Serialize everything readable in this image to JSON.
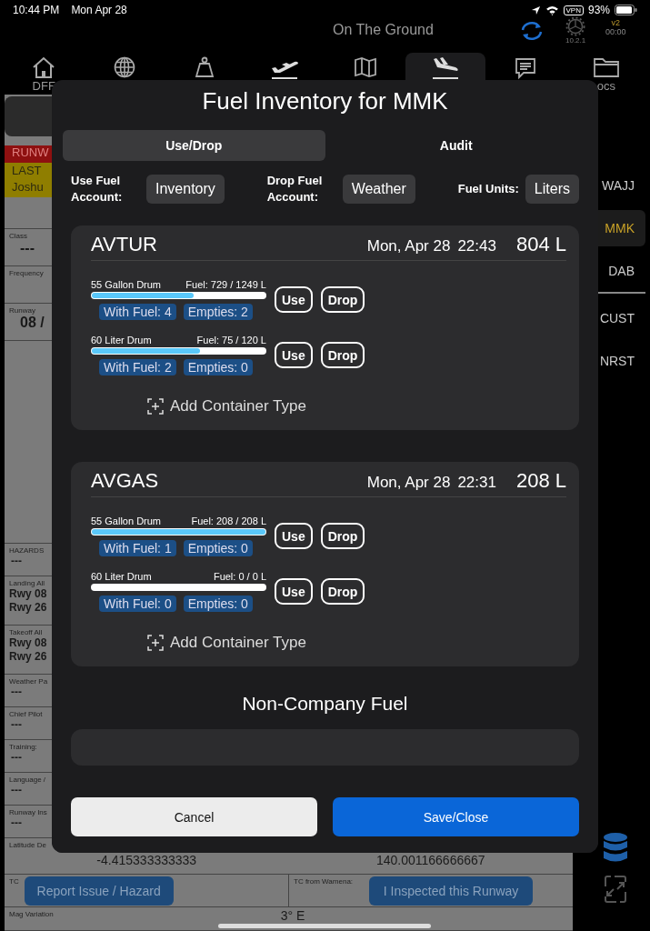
{
  "status_bar": {
    "time": "10:44 PM",
    "date": "Mon Apr 28",
    "vpn": "VPN",
    "battery": "93%"
  },
  "header": {
    "title": "On The Ground",
    "version": "10.2.1",
    "badge": "v2",
    "timer": "00:00"
  },
  "tabs": [
    {
      "kind": "home",
      "label": "DFF",
      "selected": false
    },
    {
      "kind": "globe",
      "selected": false
    },
    {
      "kind": "weight",
      "selected": false
    },
    {
      "kind": "takeoff",
      "selected": false
    },
    {
      "kind": "map",
      "selected": false
    },
    {
      "kind": "landing",
      "selected": true
    },
    {
      "kind": "chat",
      "selected": false
    },
    {
      "kind": "folder",
      "label": "ocs",
      "selected": false
    }
  ],
  "runway_panel": {
    "banner": "RUNW",
    "notice": [
      "LAST",
      "Joshu"
    ],
    "upper_fields": [
      {
        "label": "Class",
        "values": [
          "---"
        ]
      },
      {
        "label": "Frequency"
      },
      {
        "label": "Runway",
        "values": [
          "08 /"
        ]
      }
    ],
    "lower_fields": [
      {
        "label": "HAZARDS",
        "values": [
          "---"
        ]
      },
      {
        "label": "Landing All",
        "values": [
          "Rwy 08",
          "Rwy 26"
        ]
      },
      {
        "label": "Takeoff All",
        "values": [
          "Rwy 08",
          "Rwy 26"
        ]
      },
      {
        "label": "Weather Pa",
        "values": [
          "---"
        ]
      },
      {
        "label": "Chief Pilot",
        "values": [
          "---"
        ]
      },
      {
        "label": "Training:",
        "values": [
          "---"
        ]
      },
      {
        "label": "Language /",
        "values": [
          "---"
        ]
      },
      {
        "label": "Runway Ins",
        "values": [
          "---"
        ]
      }
    ],
    "coordinates": {
      "label": "Latitude De",
      "latitude": "-4.415333333333",
      "longitude": "140.001166666667"
    },
    "tc_row": {
      "left_label": "TC",
      "right_label": "TC from Wamena:"
    },
    "mag_variation": {
      "label": "Mag Variation",
      "value": "3° E"
    },
    "actions": [
      "Report Issue / Hazard",
      "I Inspected this Runway"
    ]
  },
  "sidebar": {
    "airports": [
      {
        "code": "WAJJ",
        "selected": false
      },
      {
        "code": "MMK",
        "selected": true
      },
      {
        "code": "DAB",
        "selected": false
      }
    ],
    "views": [
      "CUST",
      "NRST"
    ]
  },
  "modal": {
    "title": "Fuel Inventory for MMK",
    "segments": [
      {
        "label": "Use/Drop",
        "selected": true
      },
      {
        "label": "Audit",
        "selected": false
      }
    ],
    "accounts": [
      {
        "label": "Use Fuel Account:",
        "value": "Inventory"
      },
      {
        "label": "Drop Fuel Account:",
        "value": "Weather"
      },
      {
        "label": "Fuel Units:",
        "value": "Liters"
      }
    ],
    "fuels": [
      {
        "name": "AVTUR",
        "date": "Mon, Apr 28",
        "time": "22:43",
        "total": "804 L",
        "add": "Add Container Type",
        "containers": [
          {
            "name": "55 Gallon Drum",
            "fuel": "Fuel: 729 / 1249 L",
            "level": 0.584,
            "with_fuel": "With Fuel: 4",
            "empties": "Empties: 2",
            "use": "Use",
            "drop": "Drop"
          },
          {
            "name": "60 Liter Drum",
            "fuel": "Fuel: 75 / 120 L",
            "level": 0.625,
            "with_fuel": "With Fuel: 2",
            "empties": "Empties: 0",
            "use": "Use",
            "drop": "Drop"
          }
        ]
      },
      {
        "name": "AVGAS",
        "date": "Mon, Apr 28",
        "time": "22:31",
        "total": "208 L",
        "add": "Add Container Type",
        "containers": [
          {
            "name": "55 Gallon Drum",
            "fuel": "Fuel: 208 / 208 L",
            "level": 1,
            "with_fuel": "With Fuel: 1",
            "empties": "Empties: 0",
            "use": "Use",
            "drop": "Drop"
          },
          {
            "name": "60 Liter Drum",
            "fuel": "Fuel: 0 / 0 L",
            "level": 0,
            "with_fuel": "With Fuel: 0",
            "empties": "Empties: 0",
            "use": "Use",
            "drop": "Drop"
          }
        ]
      }
    ],
    "section_title": "Non-Company Fuel",
    "cancel": "Cancel",
    "save": "Save/Close"
  }
}
